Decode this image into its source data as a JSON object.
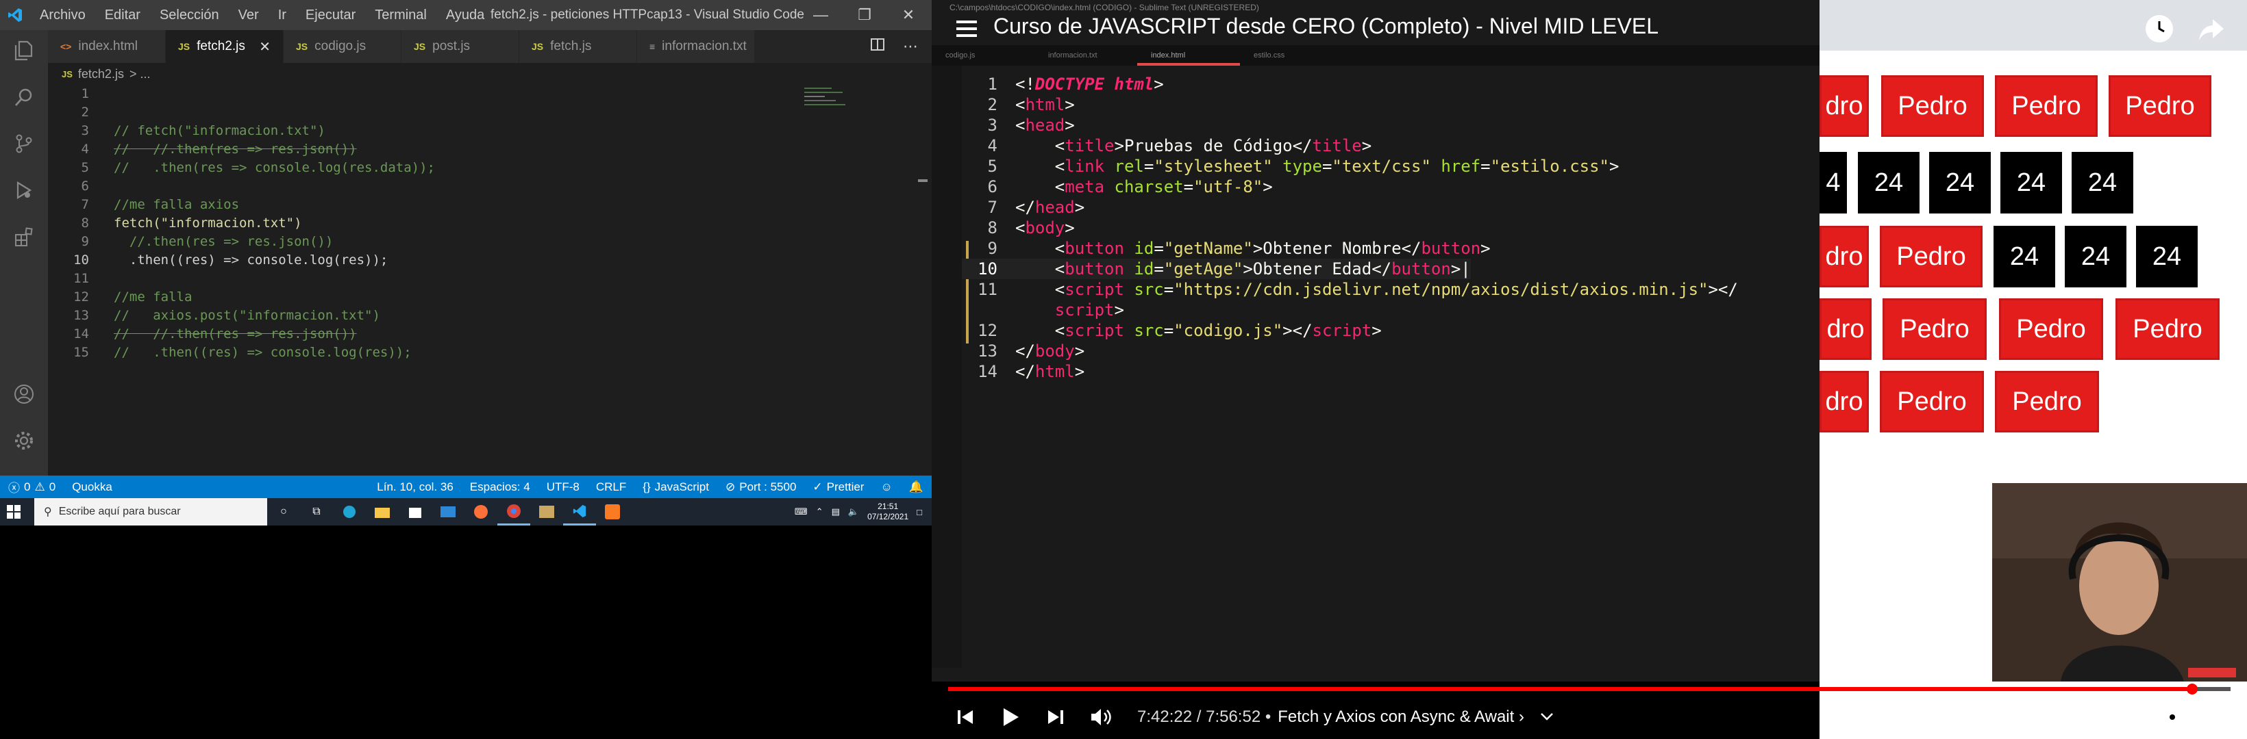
{
  "vscode": {
    "menu": [
      "Archivo",
      "Editar",
      "Selección",
      "Ver",
      "Ir",
      "Ejecutar",
      "Terminal",
      "Ayuda"
    ],
    "window_title": "fetch2.js - peticiones HTTPcap13 - Visual Studio Code",
    "tabs": [
      {
        "lang": "<>",
        "label": "index.html",
        "active": false
      },
      {
        "lang": "JS",
        "label": "fetch2.js",
        "active": true
      },
      {
        "lang": "JS",
        "label": "codigo.js",
        "active": false
      },
      {
        "lang": "JS",
        "label": "post.js",
        "active": false
      },
      {
        "lang": "JS",
        "label": "fetch.js",
        "active": false
      },
      {
        "lang": "≡",
        "label": "informacion.txt",
        "active": false
      }
    ],
    "breadcrumb": {
      "lang": "JS",
      "file": "fetch2.js",
      "sep": "> ..."
    },
    "code": [
      {
        "n": "1",
        "text": ""
      },
      {
        "n": "2",
        "text": ""
      },
      {
        "n": "3",
        "text": "// fetch(\"informacion.txt\")"
      },
      {
        "n": "4",
        "text": "//   //.then(res => res.json())"
      },
      {
        "n": "5",
        "text": "//   .then(res => console.log(res.data));"
      },
      {
        "n": "6",
        "text": ""
      },
      {
        "n": "7",
        "text": "//me falla axios"
      },
      {
        "n": "8",
        "text": "fetch(\"informacion.txt\")"
      },
      {
        "n": "9",
        "text": "  //.then(res => res.json())"
      },
      {
        "n": "10",
        "text": "  .then((res) => console.log(res));"
      },
      {
        "n": "11",
        "text": ""
      },
      {
        "n": "12",
        "text": "//me falla"
      },
      {
        "n": "13",
        "text": "//   axios.post(\"informacion.txt\")"
      },
      {
        "n": "14",
        "text": "//   //.then(res => res.json())"
      },
      {
        "n": "15",
        "text": "//   .then((res) => console.log(res));"
      }
    ],
    "status": {
      "errors": "0",
      "warnings": "0",
      "quokka": "Quokka",
      "position": "Lín. 10, col. 36",
      "spaces": "Espacios: 4",
      "encoding": "UTF-8",
      "eol": "CRLF",
      "language": "JavaScript",
      "port": "Port : 5500",
      "prettier": "Prettier"
    }
  },
  "taskbar": {
    "search_placeholder": "Escribe aquí para buscar",
    "time": "21:51",
    "date": "07/12/2021"
  },
  "video": {
    "title": "Curso de JAVASCRIPT desde CERO (Completo) - Nivel MID LEVEL",
    "time_current": "7:42:22",
    "time_total": "7:56:52",
    "chapter": "Fetch y Axios con Async & Await",
    "progress_fraction": 0.97,
    "sublime": {
      "title": "C:\\campos\\htdocs\\CODIGO\\index.html (CODIGO) - Sublime Text (UNREGISTERED)",
      "tabs": [
        "codigo.js",
        "informacion.txt",
        "index.html",
        "estilo.css"
      ],
      "active_tab": 2
    },
    "preview": {
      "rows": [
        [
          "dro",
          "Pedro",
          "Pedro",
          "Pedro"
        ],
        [
          "4",
          "24",
          "24",
          "24",
          "24"
        ],
        [
          "dro",
          "Pedro",
          "24",
          "24",
          "24"
        ],
        [
          "dro",
          "Pedro",
          "Pedro",
          "Pedro"
        ],
        [
          "dro",
          "Pedro",
          "Pedro"
        ]
      ]
    }
  },
  "colors": {
    "vscode_bg": "#1e1e1e",
    "status_bar": "#007acc",
    "youtube_red": "#ff0000",
    "box_red": "#e31c1c"
  }
}
